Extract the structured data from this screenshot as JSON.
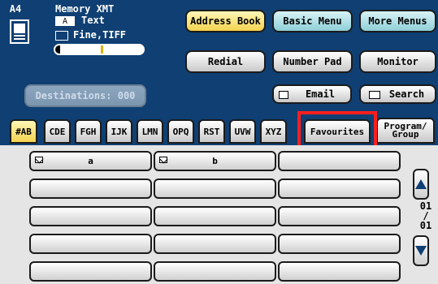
{
  "status": {
    "paper": "A4",
    "memory": "Memory XMT",
    "mode_text": "Text",
    "resolution": "Fine,TIFF",
    "destinations": "Destinations: 000"
  },
  "toolbar": {
    "address_book": "Address Book",
    "basic_menu": "Basic Menu",
    "more_menus": "More Menus",
    "redial": "Redial",
    "number_pad": "Number Pad",
    "monitor": "Monitor",
    "email": "Email",
    "search": "Search"
  },
  "tabs": [
    "#AB",
    "CDE",
    "FGH",
    "IJK",
    "LMN",
    "OPQ",
    "RST",
    "UVW",
    "XYZ",
    "Favourites",
    "Program/\nGroup"
  ],
  "entries": [
    "a",
    "b"
  ],
  "page": {
    "current": "01",
    "total": "01",
    "sep": "/"
  }
}
